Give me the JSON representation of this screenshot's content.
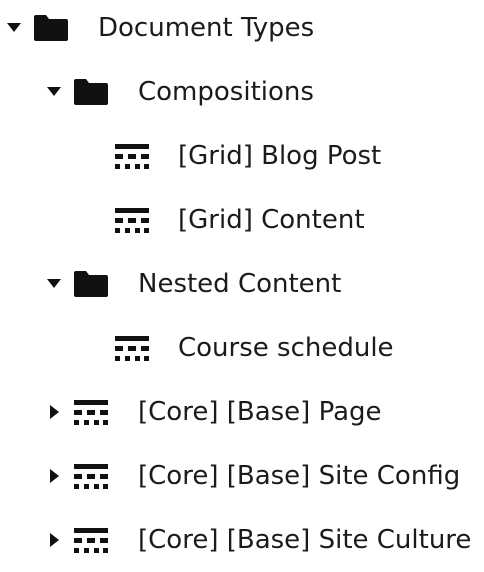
{
  "tree": {
    "root": {
      "label": "Document Types",
      "icon": "folder-icon",
      "expanded": true
    },
    "compositions": {
      "label": "Compositions",
      "icon": "folder-icon",
      "expanded": true,
      "children": [
        {
          "label": "[Grid] Blog Post",
          "icon": "document-type-icon"
        },
        {
          "label": "[Grid] Content",
          "icon": "document-type-icon"
        }
      ]
    },
    "nested_content": {
      "label": "Nested Content",
      "icon": "folder-icon",
      "expanded": true,
      "children": [
        {
          "label": "Course schedule",
          "icon": "document-type-icon"
        }
      ]
    },
    "items": [
      {
        "label": "[Core] [Base] Page",
        "icon": "document-type-icon",
        "expanded": false
      },
      {
        "label": "[Core] [Base] Site Config",
        "icon": "document-type-icon",
        "expanded": false
      },
      {
        "label": "[Core] [Base] Site Culture",
        "icon": "document-type-icon",
        "expanded": false
      }
    ]
  },
  "colors": {
    "text": "#1b1b1b",
    "icon": "#111111",
    "background": "#ffffff"
  }
}
